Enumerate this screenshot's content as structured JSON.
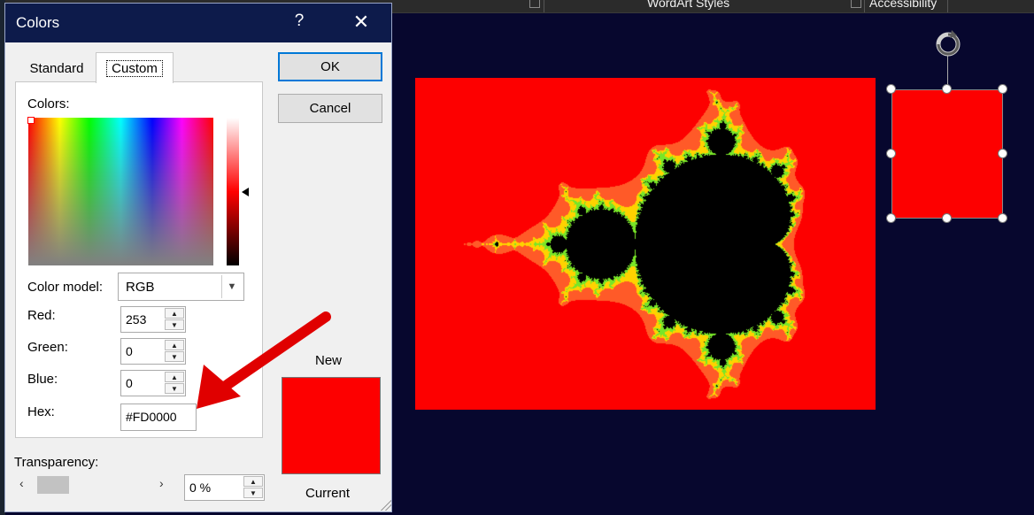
{
  "ribbon": {
    "group1_label": "WordArt Styles",
    "group2_label": "Accessibility"
  },
  "dialog": {
    "title": "Colors",
    "help_glyph": "?",
    "close_glyph": "✕",
    "tabs": [
      {
        "label": "Standard"
      },
      {
        "label": "Custom",
        "selected": true
      }
    ],
    "colors_label": "Colors:",
    "color_model_label": "Color model:",
    "color_model_value": "RGB",
    "red_label": "Red:",
    "red_value": "253",
    "green_label": "Green:",
    "green_value": "0",
    "blue_label": "Blue:",
    "blue_value": "0",
    "hex_label": "Hex:",
    "hex_value": "#FD0000",
    "ok_label": "OK",
    "cancel_label": "Cancel",
    "new_label": "New",
    "current_label": "Current",
    "transparency_label": "Transparency:",
    "transparency_value": "0 %",
    "selected_color": "#fd0000"
  },
  "icons": {
    "rotate": "rotate-icon",
    "close": "close-icon",
    "help": "help-icon",
    "spin_up": "▲",
    "spin_down": "▼",
    "dropdown": "chevron-down-icon",
    "scroll_left": "‹",
    "scroll_right": "›"
  },
  "slide": {
    "background_color": "#07072e",
    "fractal_fill": "#fd0000",
    "shape_fill": "#fd0000",
    "annotation_color": "#e00000"
  }
}
